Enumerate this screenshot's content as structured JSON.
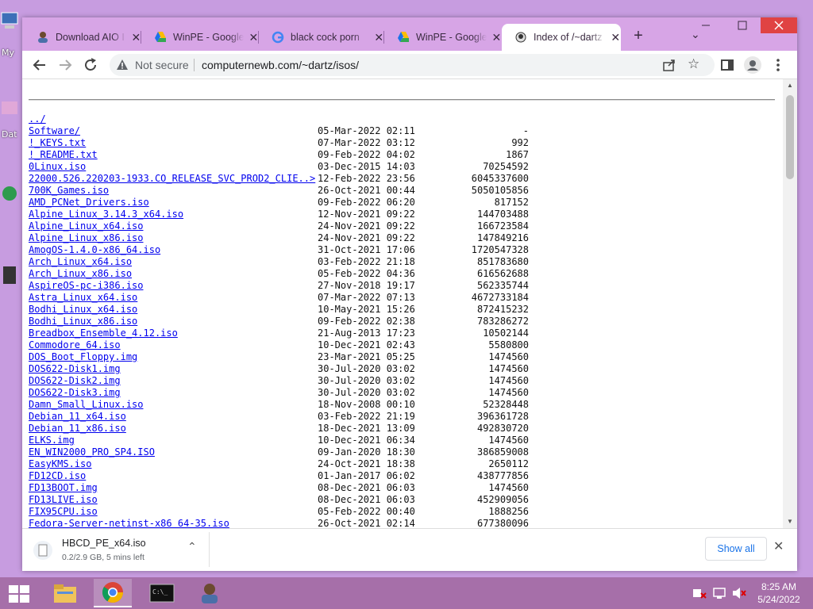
{
  "desktop": {
    "labels": [
      "My",
      "Dat"
    ]
  },
  "browser": {
    "tabs": [
      {
        "title": "Download AIO I",
        "icon": "user-icon"
      },
      {
        "title": "WinPE - Google",
        "icon": "google-drive-icon"
      },
      {
        "title": "black cock porn",
        "icon": "google-icon"
      },
      {
        "title": "WinPE - Google",
        "icon": "google-drive-icon"
      },
      {
        "title": "Index of /~dartz",
        "icon": "page-icon",
        "active": true
      }
    ],
    "new_tab_label": "+",
    "tab_search_label": "⌄",
    "address": {
      "security_label": "Not secure",
      "url": "computernewb.com/~dartz/isos/"
    },
    "colors": {
      "tabstrip": "#d7a5e6",
      "link": "#0000ee",
      "close": "#e04343",
      "taskbar": "#a66fa9"
    }
  },
  "listing": {
    "entries": [
      {
        "name": "../",
        "date": "",
        "size": ""
      },
      {
        "name": "Software/",
        "date": "05-Mar-2022 02:11",
        "size": "-"
      },
      {
        "name": "!_KEYS.txt",
        "date": "07-Mar-2022 03:12",
        "size": "992"
      },
      {
        "name": "!_README.txt",
        "date": "09-Feb-2022 04:02",
        "size": "1867"
      },
      {
        "name": "0Linux.iso",
        "date": "03-Dec-2015 14:03",
        "size": "70254592"
      },
      {
        "name": "22000.526.220203-1933.CO_RELEASE_SVC_PROD2_CLIE..>",
        "date": "12-Feb-2022 23:56",
        "size": "6045337600"
      },
      {
        "name": "700K_Games.iso",
        "date": "26-Oct-2021 00:44",
        "size": "5050105856"
      },
      {
        "name": "AMD_PCNet_Drivers.iso",
        "date": "09-Feb-2022 06:20",
        "size": "817152"
      },
      {
        "name": "Alpine_Linux_3.14.3_x64.iso",
        "date": "12-Nov-2021 09:22",
        "size": "144703488"
      },
      {
        "name": "Alpine_Linux_x64.iso",
        "date": "24-Nov-2021 09:22",
        "size": "166723584"
      },
      {
        "name": "Alpine_Linux_x86.iso",
        "date": "24-Nov-2021 09:22",
        "size": "147849216"
      },
      {
        "name": "AmogOS-1.4.0-x86_64.iso",
        "date": "31-Oct-2021 17:06",
        "size": "1720547328"
      },
      {
        "name": "Arch_Linux_x64.iso",
        "date": "03-Feb-2022 21:18",
        "size": "851783680"
      },
      {
        "name": "Arch_Linux_x86.iso",
        "date": "05-Feb-2022 04:36",
        "size": "616562688"
      },
      {
        "name": "AspireOS-pc-i386.iso",
        "date": "27-Nov-2018 19:17",
        "size": "562335744"
      },
      {
        "name": "Astra_Linux_x64.iso",
        "date": "07-Mar-2022 07:13",
        "size": "4672733184"
      },
      {
        "name": "Bodhi_Linux_x64.iso",
        "date": "10-May-2021 15:26",
        "size": "872415232"
      },
      {
        "name": "Bodhi_Linux_x86.iso",
        "date": "09-Feb-2022 02:38",
        "size": "783286272"
      },
      {
        "name": "Breadbox_Ensemble_4.12.iso",
        "date": "21-Aug-2013 17:23",
        "size": "10502144"
      },
      {
        "name": "Commodore_64.iso",
        "date": "10-Dec-2021 02:43",
        "size": "5580800"
      },
      {
        "name": "DOS_Boot_Floppy.img",
        "date": "23-Mar-2021 05:25",
        "size": "1474560"
      },
      {
        "name": "DOS622-Disk1.img",
        "date": "30-Jul-2020 03:02",
        "size": "1474560"
      },
      {
        "name": "DOS622-Disk2.img",
        "date": "30-Jul-2020 03:02",
        "size": "1474560"
      },
      {
        "name": "DOS622-Disk3.img",
        "date": "30-Jul-2020 03:02",
        "size": "1474560"
      },
      {
        "name": "Damn_Small_Linux.iso",
        "date": "18-Nov-2008 00:10",
        "size": "52328448"
      },
      {
        "name": "Debian_11_x64.iso",
        "date": "03-Feb-2022 21:19",
        "size": "396361728"
      },
      {
        "name": "Debian_11_x86.iso",
        "date": "18-Dec-2021 13:09",
        "size": "492830720"
      },
      {
        "name": "ELKS.img",
        "date": "10-Dec-2021 06:34",
        "size": "1474560"
      },
      {
        "name": "EN_WIN2000_PRO_SP4.ISO",
        "date": "09-Jan-2020 18:30",
        "size": "386859008"
      },
      {
        "name": "EasyKMS.iso",
        "date": "24-Oct-2021 18:38",
        "size": "2650112"
      },
      {
        "name": "FD12CD.iso",
        "date": "01-Jan-2017 06:02",
        "size": "438777856"
      },
      {
        "name": "FD13BOOT.img",
        "date": "08-Dec-2021 06:03",
        "size": "1474560"
      },
      {
        "name": "FD13LIVE.iso",
        "date": "08-Dec-2021 06:03",
        "size": "452909056"
      },
      {
        "name": "FIX95CPU.iso",
        "date": "05-Feb-2022 00:40",
        "size": "1888256"
      },
      {
        "name": "Fedora-Server-netinst-x86_64-35.iso",
        "date": "26-Oct-2021 02:14",
        "size": "677380096"
      }
    ]
  },
  "downloads": {
    "filename": "HBCD_PE_x64.iso",
    "status": "0.2/2.9 GB, 5 mins left",
    "show_all_label": "Show all"
  },
  "taskbar": {
    "time": "8:25 AM",
    "date": "5/24/2022"
  }
}
